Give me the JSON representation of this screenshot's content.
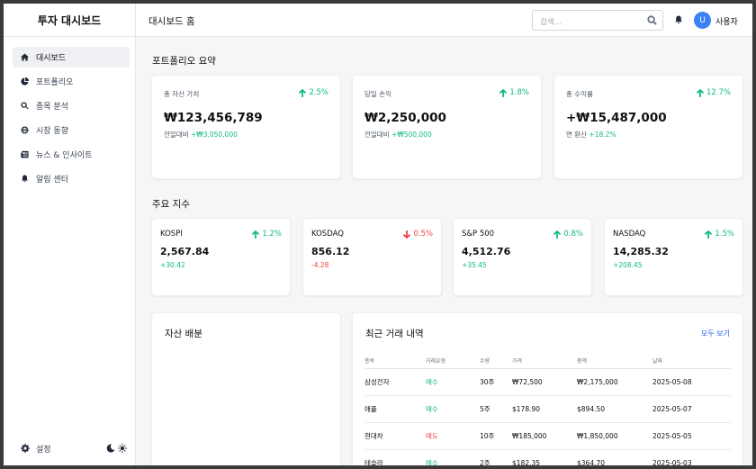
{
  "app": {
    "brand": "투자 대시보드"
  },
  "sidebar": {
    "items": [
      {
        "label": "대시보드",
        "icon": "home-icon",
        "active": true
      },
      {
        "label": "포트폴리오",
        "icon": "pie-chart-icon",
        "active": false
      },
      {
        "label": "종목 분석",
        "icon": "search-chart-icon",
        "active": false
      },
      {
        "label": "시장 동향",
        "icon": "globe-icon",
        "active": false
      },
      {
        "label": "뉴스 & 인사이트",
        "icon": "newspaper-icon",
        "active": false
      },
      {
        "label": "알림 센터",
        "icon": "bell-icon",
        "active": false
      }
    ],
    "settings_label": "설정"
  },
  "topbar": {
    "title": "대시보드 홈",
    "search_placeholder": "검색...",
    "user_initial": "U",
    "user_name": "사용자"
  },
  "summary": {
    "title": "포트폴리오 요약",
    "cards": [
      {
        "label": "총 자산 가치",
        "change": "2.5%",
        "value": "₩123,456,789",
        "sub_label": "전일대비",
        "sub_value": "+₩3,050,000"
      },
      {
        "label": "당일 손익",
        "change": "1.8%",
        "value": "₩2,250,000",
        "sub_label": "전일대비",
        "sub_value": "+₩500,000"
      },
      {
        "label": "총 수익률",
        "change": "12.7%",
        "value": "+₩15,487,000",
        "sub_label": "연 환산",
        "sub_value": "+18.2%"
      }
    ]
  },
  "indices": {
    "title": "주요 지수",
    "items": [
      {
        "name": "KOSPI",
        "change": "1.2%",
        "direction": "up",
        "value": "2,567.84",
        "delta": "+30.42"
      },
      {
        "name": "KOSDAQ",
        "change": "0.5%",
        "direction": "down",
        "value": "856.12",
        "delta": "-4.28"
      },
      {
        "name": "S&P 500",
        "change": "0.8%",
        "direction": "up",
        "value": "4,512.76",
        "delta": "+35.45"
      },
      {
        "name": "NASDAQ",
        "change": "1.5%",
        "direction": "up",
        "value": "14,285.32",
        "delta": "+208.45"
      }
    ]
  },
  "allocation": {
    "title": "자산 배분"
  },
  "transactions": {
    "title": "최근 거래 내역",
    "view_all": "모두 보기",
    "columns": [
      "종목",
      "거래유형",
      "수량",
      "가격",
      "총액",
      "날짜"
    ],
    "rows": [
      {
        "name": "삼성전자",
        "type": "매수",
        "kind": "buy",
        "qty": "30주",
        "price": "₩72,500",
        "total": "₩2,175,000",
        "date": "2025-05-08"
      },
      {
        "name": "애플",
        "type": "매수",
        "kind": "buy",
        "qty": "5주",
        "price": "$178.90",
        "total": "$894.50",
        "date": "2025-05-07"
      },
      {
        "name": "현대차",
        "type": "매도",
        "kind": "sell",
        "qty": "10주",
        "price": "₩185,000",
        "total": "₩1,850,000",
        "date": "2025-05-05"
      },
      {
        "name": "테슬라",
        "type": "매수",
        "kind": "buy",
        "qty": "2주",
        "price": "$182.35",
        "total": "$364.70",
        "date": "2025-05-03"
      }
    ]
  },
  "colors": {
    "positive": "#10b981",
    "negative": "#ef4444",
    "accent": "#3b82f6",
    "link": "#2563eb"
  }
}
